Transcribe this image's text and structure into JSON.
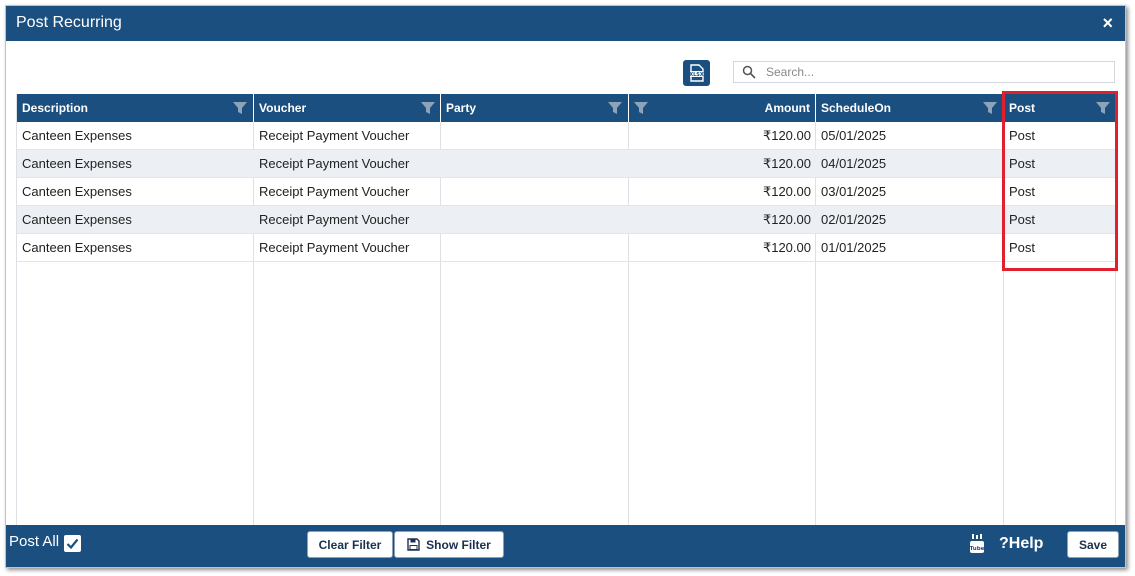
{
  "dialog": {
    "title": "Post Recurring",
    "close_label": "×"
  },
  "toolbar": {
    "search_placeholder": "Search...",
    "export_icon": "xlsx-export-icon"
  },
  "grid": {
    "columns": [
      {
        "key": "description",
        "label": "Description"
      },
      {
        "key": "voucher",
        "label": "Voucher"
      },
      {
        "key": "party",
        "label": "Party"
      },
      {
        "key": "amount",
        "label": "Amount"
      },
      {
        "key": "schedule_on",
        "label": "ScheduleOn"
      },
      {
        "key": "post",
        "label": "Post"
      }
    ],
    "rows": [
      {
        "description": "Canteen Expenses",
        "voucher": "Receipt Payment Voucher",
        "party": "",
        "amount": "₹120.00",
        "schedule_on": "05/01/2025",
        "post": "Post"
      },
      {
        "description": "Canteen Expenses",
        "voucher": "Receipt Payment Voucher",
        "party": "",
        "amount": "₹120.00",
        "schedule_on": "04/01/2025",
        "post": "Post"
      },
      {
        "description": "Canteen Expenses",
        "voucher": "Receipt Payment Voucher",
        "party": "",
        "amount": "₹120.00",
        "schedule_on": "03/01/2025",
        "post": "Post"
      },
      {
        "description": "Canteen Expenses",
        "voucher": "Receipt Payment Voucher",
        "party": "",
        "amount": "₹120.00",
        "schedule_on": "02/01/2025",
        "post": "Post"
      },
      {
        "description": "Canteen Expenses",
        "voucher": "Receipt Payment Voucher",
        "party": "",
        "amount": "₹120.00",
        "schedule_on": "01/01/2025",
        "post": "Post"
      }
    ]
  },
  "footer": {
    "post_all_label": "Post All",
    "post_all_checked": true,
    "clear_filter_label": "Clear Filter",
    "show_filter_label": "Show Filter",
    "help_label": "?Help",
    "save_label": "Save"
  },
  "colors": {
    "header": "#1b4f80",
    "highlight": "#e0202c",
    "alt_row": "#eceff3"
  }
}
